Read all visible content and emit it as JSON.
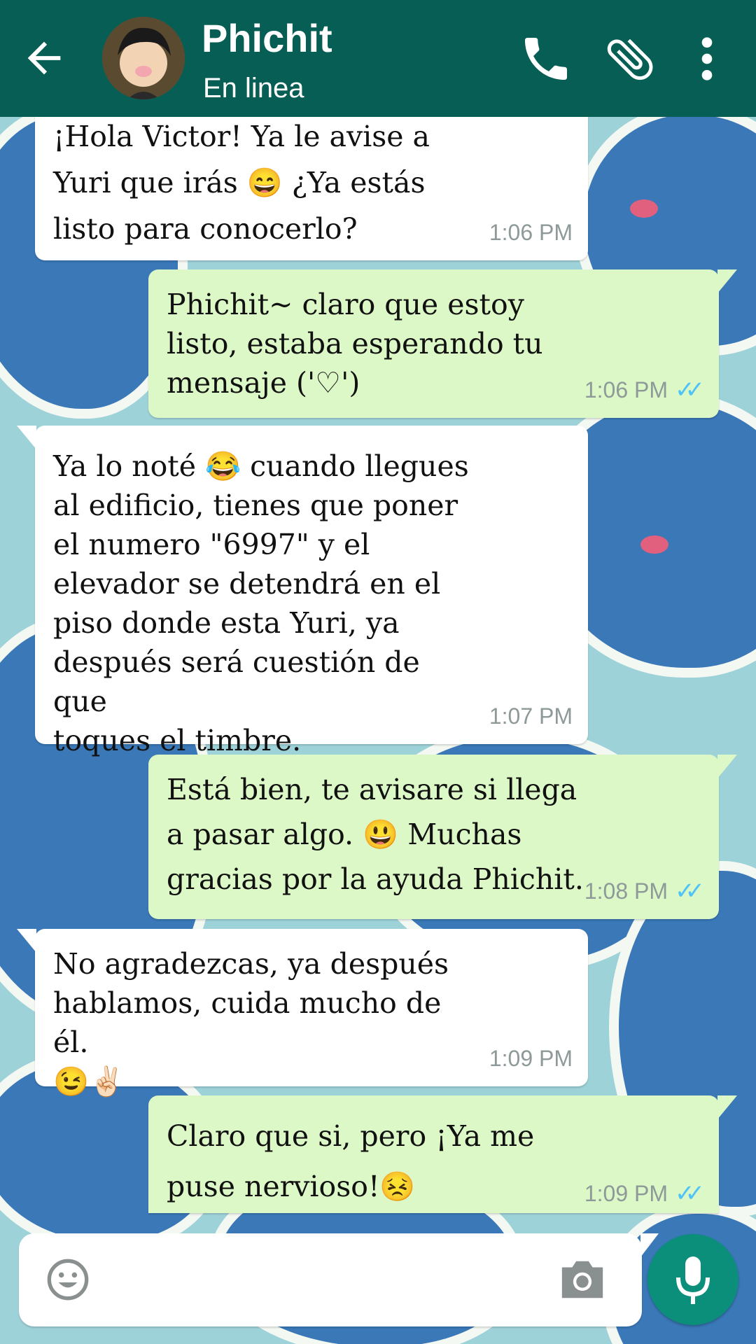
{
  "header": {
    "contact_name": "Phichit",
    "status": "En linea",
    "back_icon": "arrow-left-icon",
    "call_icon": "phone-icon",
    "attach_icon": "paperclip-icon",
    "menu_icon": "more-vert-icon"
  },
  "messages": [
    {
      "direction": "incoming",
      "text": "¡Hola Victor! Ya le avise a\nYuri que irás 😄 ¿Ya estás\nlisto para conocerlo?",
      "time": "1:06 PM"
    },
    {
      "direction": "outgoing",
      "text": "Phichit~ claro que estoy\nlisto, estaba esperando tu\nmensaje ('♡')",
      "time": "1:06 PM",
      "status_icon": "double-check-icon"
    },
    {
      "direction": "incoming",
      "text": "Ya lo noté 😂 cuando llegues\nal edificio, tienes que poner\nel numero \"6997\" y el\nelevador se detendrá en el\npiso donde esta Yuri, ya\ndespués será cuestión de que\ntoques el timbre.",
      "time": "1:07 PM"
    },
    {
      "direction": "outgoing",
      "text": "Está bien, te avisare si llega\na pasar algo. 😃 Muchas\ngracias por la ayuda Phichit.",
      "time": "1:08 PM",
      "status_icon": "double-check-icon"
    },
    {
      "direction": "incoming",
      "text": "No agradezcas, ya después\nhablamos, cuida mucho de él.\n😉✌🏻",
      "time": "1:09 PM"
    },
    {
      "direction": "outgoing",
      "text": "Claro que si, pero ¡Ya me\npuse nervioso!😣",
      "time": "1:09 PM",
      "status_icon": "double-check-icon"
    }
  ],
  "composer": {
    "placeholder": "",
    "emoji_icon": "smiley-icon",
    "camera_icon": "camera-icon",
    "mic_icon": "microphone-icon"
  },
  "colors": {
    "header": "#075e54",
    "incoming_bubble": "#ffffff",
    "outgoing_bubble": "#dcf8c6",
    "read_ticks": "#4fc3f7",
    "mic_button": "#0b8f7b"
  }
}
